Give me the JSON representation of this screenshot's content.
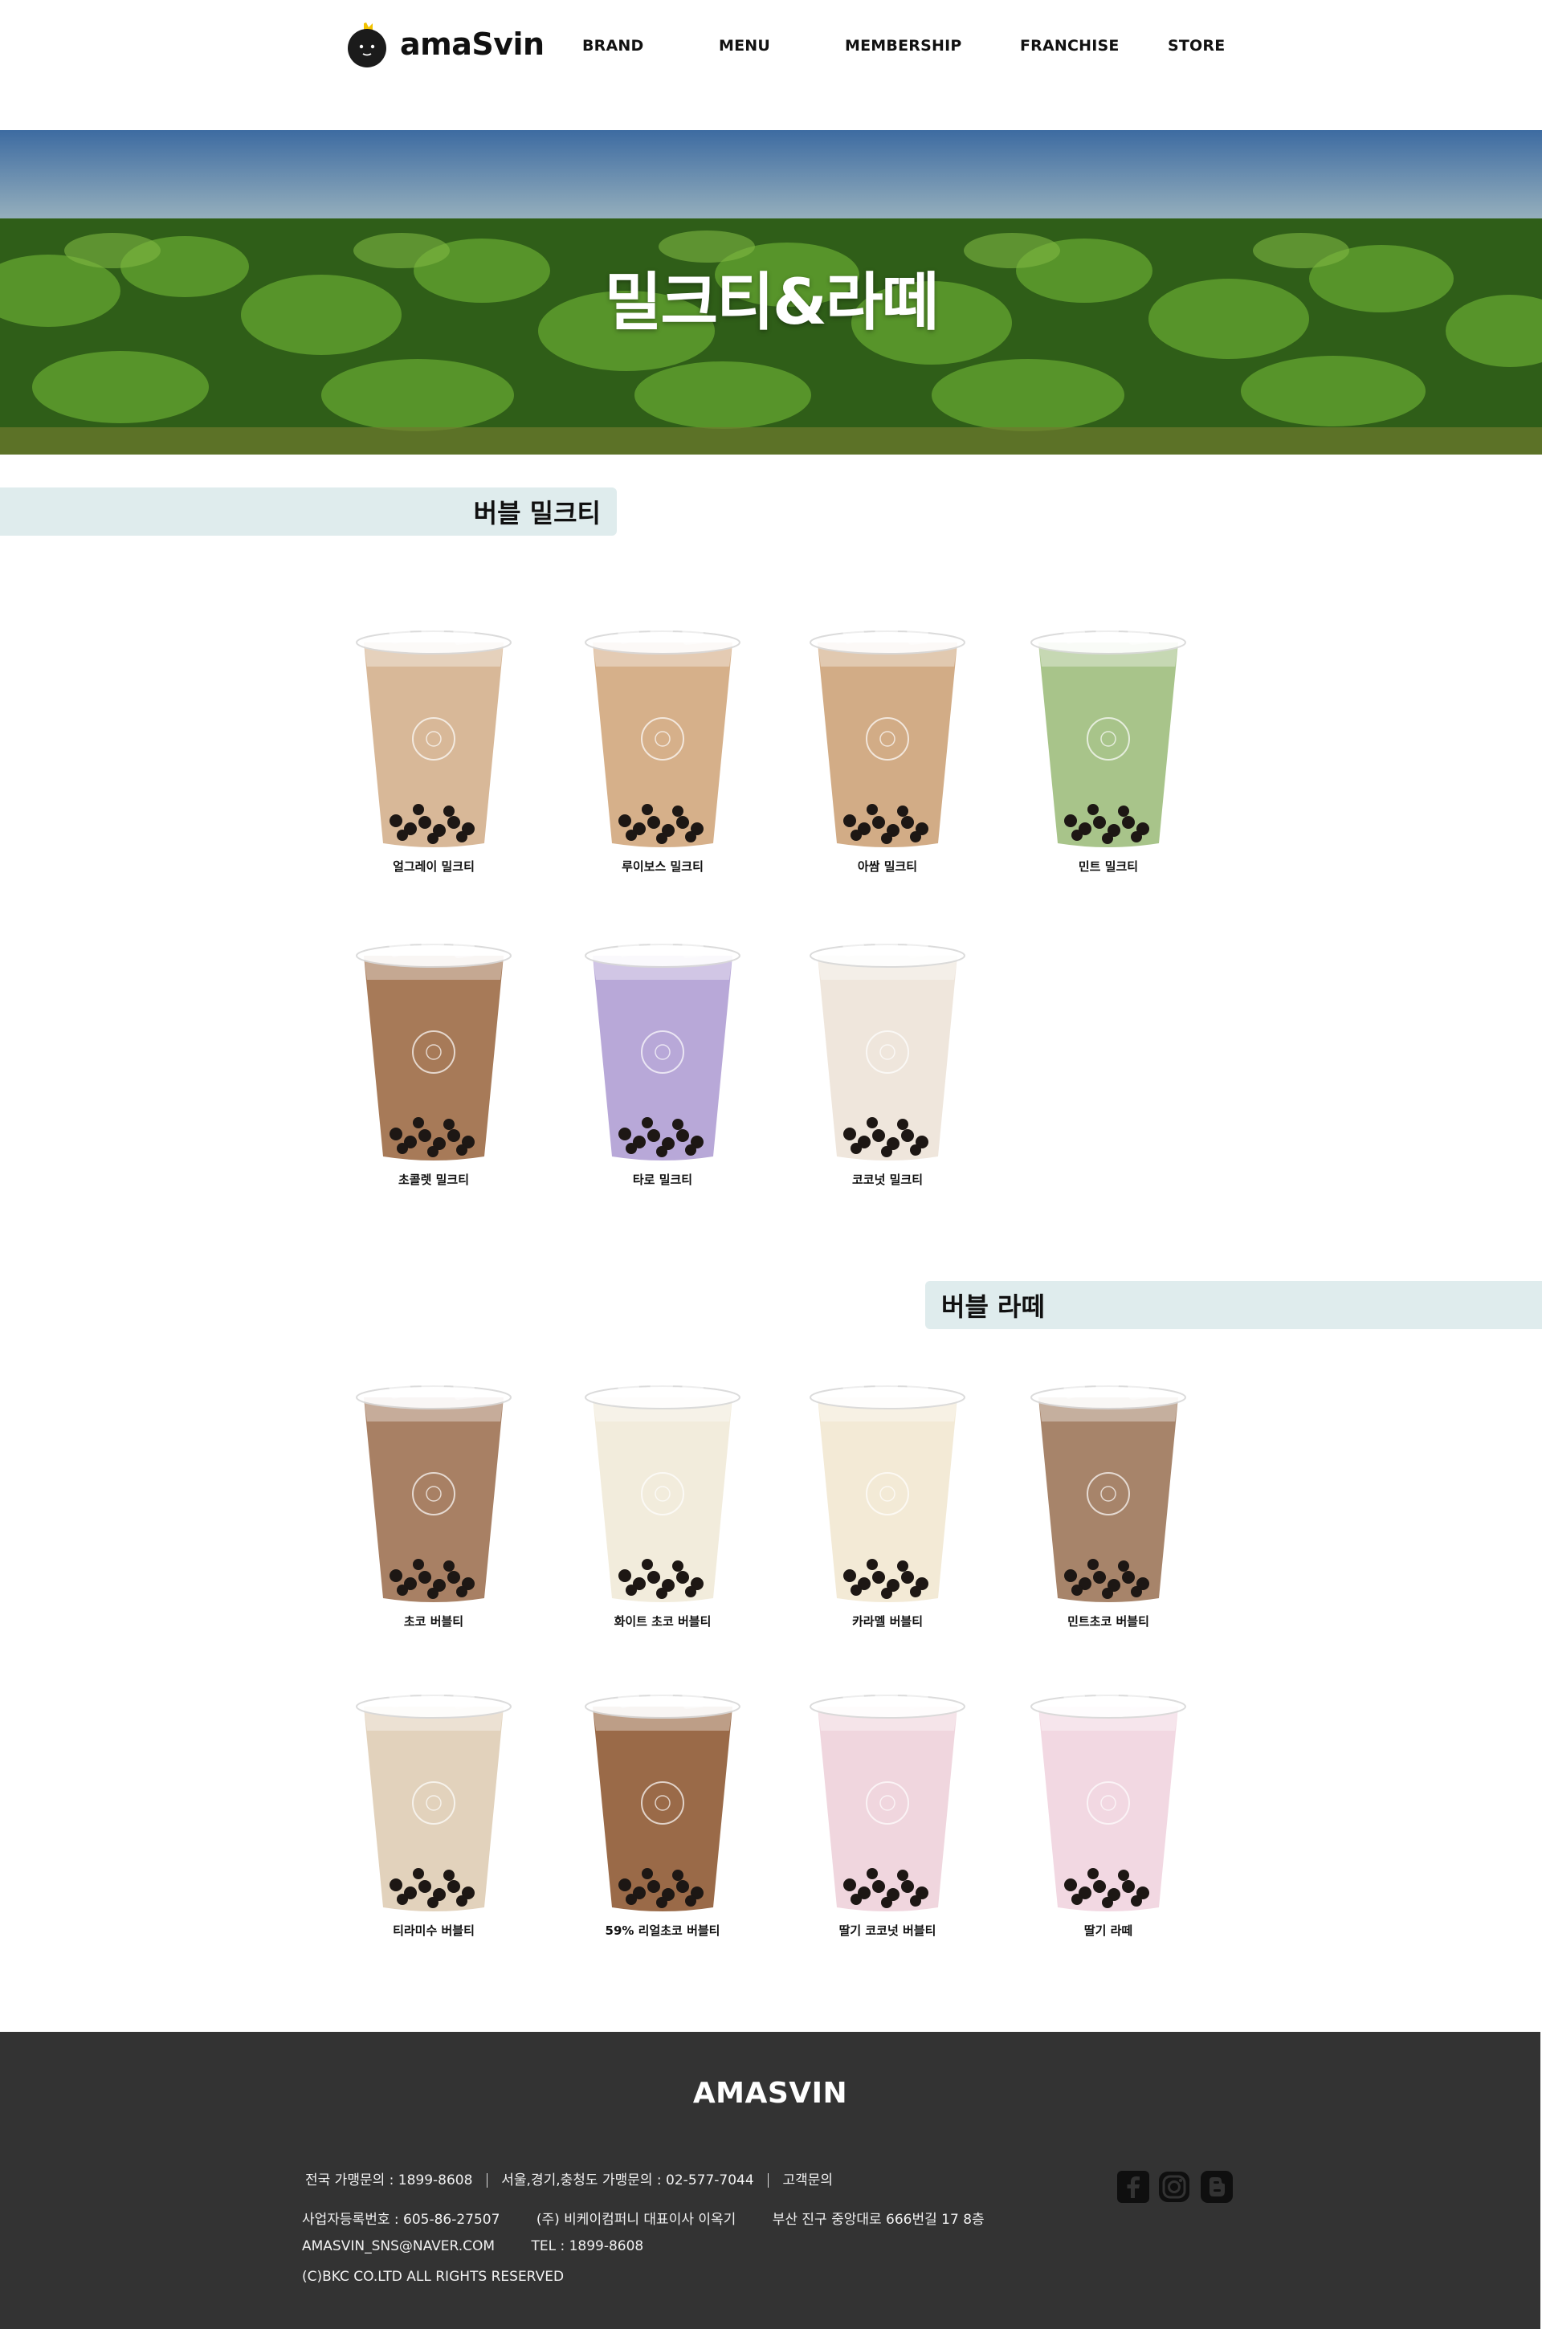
{
  "header": {
    "logo_text": "amaSvin",
    "nav": [
      "BRAND",
      "MENU",
      "MEMBERSHIP",
      "FRANCHISE",
      "STORE"
    ]
  },
  "hero": {
    "title": "밀크티&라떼"
  },
  "sections": [
    {
      "title": "버블 밀크티",
      "items": [
        {
          "name": "얼그레이 밀크티",
          "color": "#d8b898"
        },
        {
          "name": "루이보스 밀크티",
          "color": "#d6b08a"
        },
        {
          "name": "아쌈 밀크티",
          "color": "#d2ac86"
        },
        {
          "name": "민트 밀크티",
          "color": "#a8c48a"
        },
        {
          "name": "초콜렛 밀크티",
          "color": "#a77a58"
        },
        {
          "name": "타로 밀크티",
          "color": "#b8a8d8"
        },
        {
          "name": "코코넛 밀크티",
          "color": "#efe6dc"
        }
      ]
    },
    {
      "title": "버블 라떼",
      "items": [
        {
          "name": "초코 버블티",
          "color": "#a88064"
        },
        {
          "name": "화이트 초코 버블티",
          "color": "#f2ecdc"
        },
        {
          "name": "카라멜 버블티",
          "color": "#f3ead6"
        },
        {
          "name": "민트초코 버블티",
          "color": "#a7846a"
        },
        {
          "name": "티라미수 버블티",
          "color": "#e2d2bc"
        },
        {
          "name": "59% 리얼초코 버블티",
          "color": "#9a6a48"
        },
        {
          "name": "딸기 코코넛 버블티",
          "color": "#f0d6de"
        },
        {
          "name": "딸기 라떼",
          "color": "#f2d8e2"
        }
      ]
    }
  ],
  "footer": {
    "brand": "AMASVIN",
    "contact": [
      "전국 가맹문의 : 1899-8608",
      "서울,경기,충청도 가맹문의 : 02-577-7044",
      "고객문의"
    ],
    "business_no": "사업자등록번호 : 605-86-27507",
    "company": "(주) 비케이컴퍼니 대표이사 이옥기",
    "address": "부산 진구 중앙대로 666번길 17 8층",
    "email": "AMASVIN_SNS@NAVER.COM",
    "tel": "TEL : 1899-8608",
    "copyright": "(C)BKC CO.LTD ALL RIGHTS RESERVED",
    "social": [
      "facebook-icon",
      "instagram-icon",
      "blogger-icon"
    ]
  },
  "colors": {
    "tab_bg": "#dfeced",
    "footer_bg": "#333333"
  }
}
